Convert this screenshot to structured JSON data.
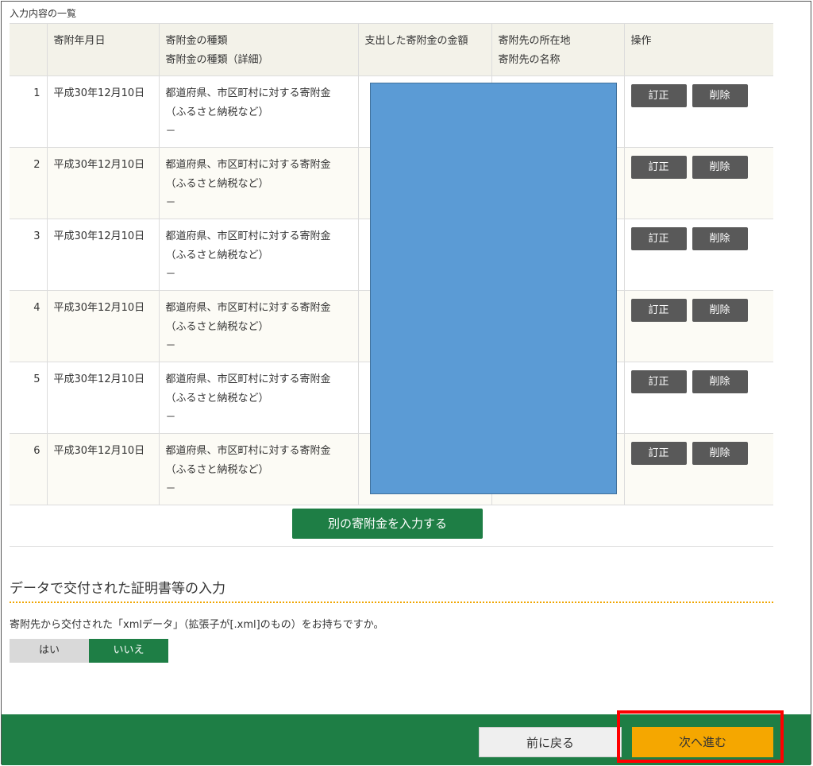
{
  "section_caption": "入力内容の一覧",
  "table": {
    "headers": {
      "num": "",
      "date": "寄附年月日",
      "kind": [
        "寄附金の種類",
        "寄附金の種類（詳細）"
      ],
      "amount": "支出した寄附金の金額",
      "place": [
        "寄附先の所在地",
        "寄附先の名称"
      ],
      "ops": "操作"
    },
    "rows": [
      {
        "num": "1",
        "date": "平成30年12月10日",
        "kind": "都道府県、市区町村に対する寄附金",
        "detail": "（ふるさと納税など）",
        "extra": "－",
        "edit": "訂正",
        "delete": "削除"
      },
      {
        "num": "2",
        "date": "平成30年12月10日",
        "kind": "都道府県、市区町村に対する寄附金",
        "detail": "（ふるさと納税など）",
        "extra": "－",
        "edit": "訂正",
        "delete": "削除"
      },
      {
        "num": "3",
        "date": "平成30年12月10日",
        "kind": "都道府県、市区町村に対する寄附金",
        "detail": "（ふるさと納税など）",
        "extra": "－",
        "edit": "訂正",
        "delete": "削除"
      },
      {
        "num": "4",
        "date": "平成30年12月10日",
        "kind": "都道府県、市区町村に対する寄附金",
        "detail": "（ふるさと納税など）",
        "extra": "－",
        "edit": "訂正",
        "delete": "削除"
      },
      {
        "num": "5",
        "date": "平成30年12月10日",
        "kind": "都道府県、市区町村に対する寄附金",
        "detail": "（ふるさと納税など）",
        "extra": "－",
        "edit": "訂正",
        "delete": "削除"
      },
      {
        "num": "6",
        "date": "平成30年12月10日",
        "kind": "都道府県、市区町村に対する寄附金",
        "detail": "（ふるさと納税など）",
        "extra": "－",
        "edit": "訂正",
        "delete": "削除"
      }
    ]
  },
  "add_button": "別の寄附金を入力する",
  "xml_section": {
    "heading": "データで交付された証明書等の入力",
    "question": "寄附先から交付された「xmlデータ」（拡張子が[.xml]のもの）をお持ちですか。",
    "yes": "はい",
    "no": "いいえ",
    "selected": "no"
  },
  "footer": {
    "back": "前に戻る",
    "next": "次へ進む"
  },
  "colors": {
    "primary_green": "#1e7e45",
    "next_orange": "#f5a700",
    "highlight_red": "#ff0000",
    "redaction_blue": "#5b9bd5"
  }
}
